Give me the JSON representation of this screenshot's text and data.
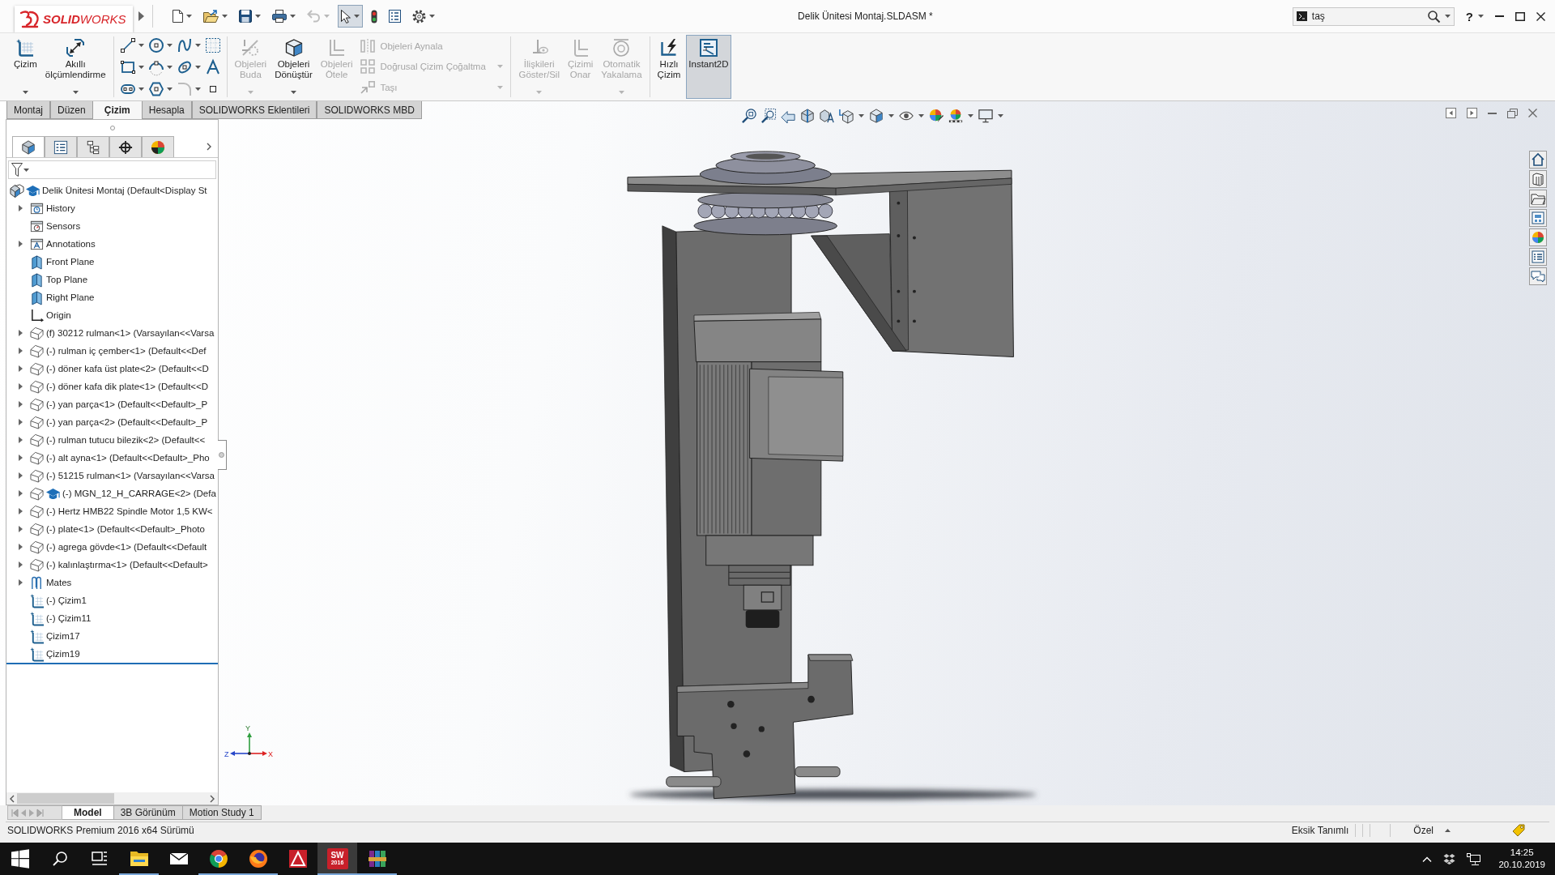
{
  "title_bar": {
    "logo": "**SOLID**WORKS",
    "document_title": "Delik Ünitesi Montaj.SLDASM *",
    "search": {
      "value": "taş"
    },
    "help": "?"
  },
  "quick_access": [
    {
      "kind": "new",
      "dropdown": true,
      "disabled": false,
      "selected": false
    },
    {
      "kind": "open",
      "dropdown": true,
      "disabled": false,
      "selected": false
    },
    {
      "kind": "save",
      "dropdown": true,
      "disabled": false,
      "selected": false
    },
    {
      "kind": "print",
      "dropdown": true,
      "disabled": false,
      "selected": false
    },
    {
      "kind": "undo",
      "dropdown": true,
      "disabled": true,
      "selected": false
    },
    {
      "kind": "select",
      "dropdown": true,
      "disabled": false,
      "selected": true
    },
    {
      "kind": "rebuild",
      "dropdown": false,
      "disabled": false,
      "selected": false
    },
    {
      "kind": "file-properties",
      "dropdown": false,
      "disabled": false,
      "selected": false
    },
    {
      "kind": "options",
      "dropdown": true,
      "disabled": false,
      "selected": false
    }
  ],
  "command_manager": [
    {
      "sections": [
        {
          "kind": "large",
          "buttons": [
            {
              "kind": "sketch",
              "label": "Çizim",
              "disabled": false,
              "dropdown": true,
              "selected": false
            },
            {
              "kind": "smart-dimension",
              "label": "Akıllı ölçümlendirme",
              "disabled": false,
              "dropdown": true,
              "selected": false
            }
          ]
        }
      ]
    },
    {
      "sections": [
        {
          "kind": "tools"
        }
      ]
    },
    {
      "sections": [
        {
          "kind": "large",
          "buttons": [
            {
              "kind": "trim",
              "label": "Objeleri Buda",
              "disabled": true,
              "dropdown": true,
              "selected": false
            },
            {
              "kind": "convert",
              "label": "Objeleri Dönüştür",
              "disabled": false,
              "dropdown": true,
              "selected": false
            },
            {
              "kind": "offset",
              "label": "Objeleri Ötele",
              "disabled": true,
              "dropdown": false,
              "selected": false
            }
          ]
        },
        {
          "kind": "stack",
          "buttons": [
            {
              "kind": "mirror",
              "label": "Objeleri Aynala",
              "disabled": true,
              "dropdown": false,
              "selected": false
            },
            {
              "kind": "pattern",
              "label": "Doğrusal Çizim Çoğaltma",
              "disabled": true,
              "dropdown": true,
              "selected": false
            },
            {
              "kind": "move",
              "label": "Taşı",
              "disabled": true,
              "dropdown": true,
              "selected": false
            }
          ]
        }
      ]
    },
    {
      "sections": [
        {
          "kind": "large",
          "buttons": [
            {
              "kind": "relations",
              "label": "İlişkileri Göster/Sil",
              "disabled": true,
              "dropdown": true,
              "selected": false
            },
            {
              "kind": "repair",
              "label": "Çizimi Onar",
              "disabled": true,
              "dropdown": false,
              "selected": false
            },
            {
              "kind": "quick-snaps",
              "label": "Otomatik Yakalama",
              "disabled": true,
              "dropdown": true,
              "selected": false
            }
          ]
        }
      ]
    },
    {
      "sections": [
        {
          "kind": "large",
          "buttons": [
            {
              "kind": "rapid-sketch",
              "label": "Hızlı Çizim",
              "disabled": false,
              "dropdown": false,
              "selected": false
            },
            {
              "kind": "instant2d",
              "label": "Instant2D",
              "disabled": false,
              "dropdown": false,
              "selected": true
            }
          ]
        }
      ]
    }
  ],
  "tabs": [
    {
      "label": "Montaj",
      "selected": false
    },
    {
      "label": "Düzen",
      "selected": false
    },
    {
      "label": "Çizim",
      "selected": true
    },
    {
      "label": "Hesapla",
      "selected": false
    },
    {
      "label": "SOLIDWORKS Eklentileri",
      "selected": false
    },
    {
      "label": "SOLIDWORKS MBD",
      "selected": false
    }
  ],
  "feature_manager": {
    "tabs": [
      {
        "kind": "feature-tree",
        "selected": true
      },
      {
        "kind": "property",
        "selected": false
      },
      {
        "kind": "configuration",
        "selected": false
      },
      {
        "kind": "dimxpert",
        "selected": false
      },
      {
        "kind": "display",
        "selected": false
      }
    ],
    "tree": {
      "label": "Delik Ünitesi Montaj (Default<Display St",
      "kind": "assembly",
      "children": [
        {
          "label": "History",
          "kind": "history",
          "expandable": true
        },
        {
          "label": "Sensors",
          "kind": "sensors",
          "expandable": false
        },
        {
          "label": "Annotations",
          "kind": "annotations",
          "expandable": true
        },
        {
          "label": "Front Plane",
          "kind": "plane",
          "expandable": false
        },
        {
          "label": "Top Plane",
          "kind": "plane",
          "expandable": false
        },
        {
          "label": "Right Plane",
          "kind": "plane",
          "expandable": false
        },
        {
          "label": "Origin",
          "kind": "origin",
          "expandable": false
        },
        {
          "label": "(f) 30212 rulman<1> (Varsayılan<<Varsa",
          "kind": "part",
          "expandable": true
        },
        {
          "label": "(-) rulman iç çember<1> (Default<<Def",
          "kind": "part",
          "expandable": true
        },
        {
          "label": "(-) döner kafa üst plate<2> (Default<<D",
          "kind": "part",
          "expandable": true
        },
        {
          "label": "(-) döner kafa dik plate<1> (Default<<D",
          "kind": "part",
          "expandable": true
        },
        {
          "label": "(-) yan parça<1> (Default<<Default>_P",
          "kind": "part",
          "expandable": true
        },
        {
          "label": "(-) yan parça<2> (Default<<Default>_P",
          "kind": "part",
          "expandable": true
        },
        {
          "label": "(-) rulman tutucu bilezik<2> (Default<<",
          "kind": "part",
          "expandable": true
        },
        {
          "label": "(-) alt ayna<1> (Default<<Default>_Pho",
          "kind": "part",
          "expandable": true
        },
        {
          "label": "(-) 51215 rulman<1> (Varsayılan<<Varsa",
          "kind": "part",
          "expandable": true
        },
        {
          "label": "(-) MGN_12_H_CARRAGE<2> (Defa",
          "kind": "toolbox-part",
          "expandable": true
        },
        {
          "label": "(-) Hertz HMB22 Spindle Motor 1,5 KW<",
          "kind": "part",
          "expandable": true
        },
        {
          "label": "(-) plate<1> (Default<<Default>_Photo",
          "kind": "part",
          "expandable": true
        },
        {
          "label": "(-) agrega gövde<1> (Default<<Default",
          "kind": "part",
          "expandable": true
        },
        {
          "label": "(-) kalınlaştırma<1> (Default<<Default>",
          "kind": "part",
          "expandable": true
        },
        {
          "label": "Mates",
          "kind": "mates",
          "expandable": true
        },
        {
          "label": "(-) Çizim1",
          "kind": "sketch",
          "expandable": false
        },
        {
          "label": "(-) Çizim11",
          "kind": "sketch",
          "expandable": false
        },
        {
          "label": "Çizim17",
          "kind": "sketch",
          "expandable": false
        },
        {
          "label": "Çizim19",
          "kind": "sketch",
          "expandable": false
        }
      ]
    }
  },
  "graphics": {
    "triad_labels": [
      "Y",
      "Z",
      "X"
    ]
  },
  "bottom_tabs": [
    {
      "label": "Model",
      "selected": true
    },
    {
      "label": "3B Görünüm",
      "selected": false
    },
    {
      "label": "Motion Study 1",
      "selected": false
    }
  ],
  "status_bar": {
    "message": "SOLIDWORKS Premium 2016 x64 Sürümü",
    "sketch_state": "Eksik Tanımlı",
    "units": "Özel"
  },
  "taskbar": {
    "apps": [
      {
        "kind": "folder",
        "running": true,
        "selected": false
      },
      {
        "kind": "mail",
        "running": false,
        "selected": false
      },
      {
        "kind": "browser-circle",
        "running": true,
        "selected": false
      },
      {
        "kind": "browser-globe",
        "running": true,
        "selected": false
      },
      {
        "kind": "cad-triangle",
        "running": false,
        "selected": false
      },
      {
        "kind": "cad-tile",
        "running": true,
        "selected": true,
        "icon_text": [
          "SW",
          "2016"
        ]
      },
      {
        "kind": "archive",
        "running": true,
        "selected": false
      }
    ],
    "clock": {
      "time": "14:25",
      "date": "20.10.2019"
    }
  }
}
